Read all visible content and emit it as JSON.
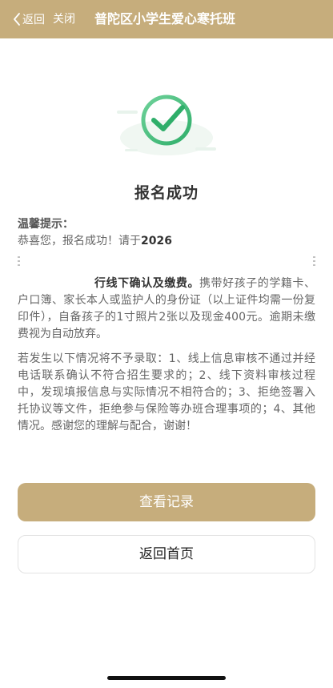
{
  "nav": {
    "back_label": "返回",
    "close_label": "关闭",
    "title": "普陀区小学生爱心寒托班"
  },
  "result": {
    "status_icon": "check-circle-icon",
    "title": "报名成功"
  },
  "tips": {
    "label": "温馨提示：",
    "para1_start": "恭喜您，报名成功！请于",
    "para1_year": "2026",
    "para1_bold_tail": "行线下确认及缴费。",
    "para1_rest": "携带好孩子的学籍卡、户口簿、家长本人或监护人的身份证（以上证件均需一份复印件），自备孩子的1寸照片2张以及现金400元。逾期未缴费视为自动放弃。",
    "para2": "若发生以下情况将不予录取：1、线上信息审核不通过并经电话联系确认不符合招生要求的；2、线下资料审核过程中，发现填报信息与实际情况不相符合的；3、拒绝签署入托协议等文件，拒绝参与保险等办班合理事项的；4、其他情况。感谢您的理解与配合，谢谢！"
  },
  "actions": {
    "view_records": "查看记录",
    "back_home": "返回首页"
  },
  "colors": {
    "brand_gold": "#c6ad7c",
    "success_green": "#3dbb78"
  }
}
